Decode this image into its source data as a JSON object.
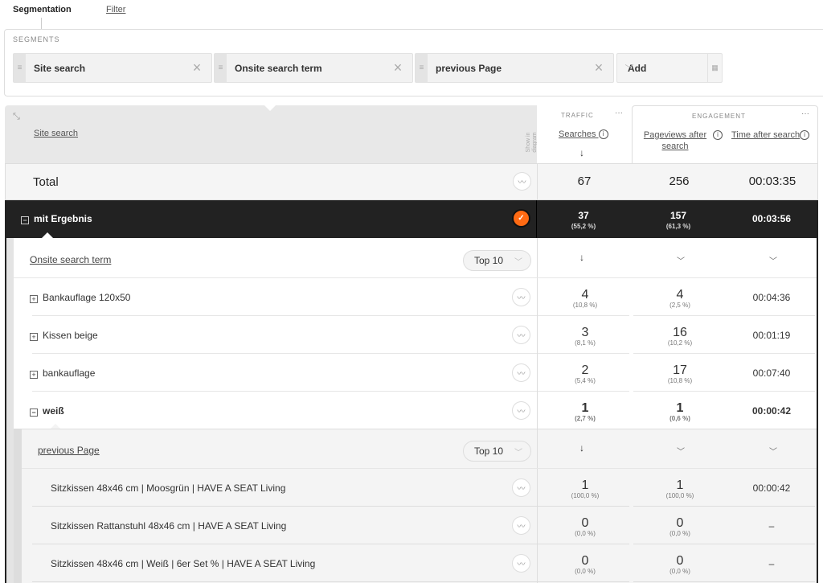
{
  "tabs": {
    "segmentation": "Segmentation",
    "filter": "Filter"
  },
  "segments": {
    "title": "SEGMENTS",
    "chips": [
      {
        "label": "Site search"
      },
      {
        "label": "Onsite search term"
      },
      {
        "label": "previous Page"
      }
    ],
    "add_label": "Add"
  },
  "table": {
    "dimension_header": "Site search",
    "show_in_diagram": "Show in diagram",
    "groups": {
      "traffic": "TRAFFIC",
      "engagement": "ENGAGEMENT"
    },
    "metrics": [
      "Searches",
      "Pageviews after search",
      "Time after search"
    ],
    "total": {
      "label": "Total",
      "values": [
        "67",
        "256",
        "00:03:35"
      ]
    },
    "level0": {
      "label": "mit Ergebnis",
      "values": [
        {
          "n": "37",
          "p": "(55,2 %)"
        },
        {
          "n": "157",
          "p": "(61,3 %)"
        },
        {
          "n": "00:03:56",
          "p": ""
        }
      ]
    },
    "level1": {
      "header": "Onsite search term",
      "top_label": "Top 10",
      "rows": [
        {
          "label": "Bankauflage 120x50",
          "v": [
            {
              "n": "4",
              "p": "(10,8 %)"
            },
            {
              "n": "4",
              "p": "(2,5 %)"
            },
            {
              "n": "00:04:36",
              "p": ""
            }
          ]
        },
        {
          "label": "Kissen beige",
          "v": [
            {
              "n": "3",
              "p": "(8,1 %)"
            },
            {
              "n": "16",
              "p": "(10,2 %)"
            },
            {
              "n": "00:01:19",
              "p": ""
            }
          ]
        },
        {
          "label": "bankauflage",
          "v": [
            {
              "n": "2",
              "p": "(5,4 %)"
            },
            {
              "n": "17",
              "p": "(10,8 %)"
            },
            {
              "n": "00:07:40",
              "p": ""
            }
          ]
        },
        {
          "label": "weiß",
          "v": [
            {
              "n": "1",
              "p": "(2,7 %)"
            },
            {
              "n": "1",
              "p": "(0,6 %)"
            },
            {
              "n": "00:00:42",
              "p": ""
            }
          ]
        }
      ]
    },
    "level2": {
      "header": "previous Page",
      "top_label": "Top 10",
      "rows": [
        {
          "label": "Sitzkissen 48x46 cm | Moosgrün | HAVE A SEAT Living",
          "v": [
            {
              "n": "1",
              "p": "(100,0 %)"
            },
            {
              "n": "1",
              "p": "(100,0 %)"
            },
            {
              "n": "00:00:42",
              "p": ""
            }
          ]
        },
        {
          "label": "Sitzkissen Rattanstuhl 48x46 cm | HAVE A SEAT Living",
          "v": [
            {
              "n": "0",
              "p": "(0,0 %)"
            },
            {
              "n": "0",
              "p": "(0,0 %)"
            },
            {
              "n": "–",
              "p": ""
            }
          ]
        },
        {
          "label": "Sitzkissen 48x46 cm | Weiß | 6er Set % | HAVE A SEAT Living",
          "v": [
            {
              "n": "0",
              "p": "(0,0 %)"
            },
            {
              "n": "0",
              "p": "(0,0 %)"
            },
            {
              "n": "–",
              "p": ""
            }
          ]
        }
      ]
    }
  },
  "colors": {
    "accent": "#ff6a13",
    "dark_row": "#222222"
  }
}
